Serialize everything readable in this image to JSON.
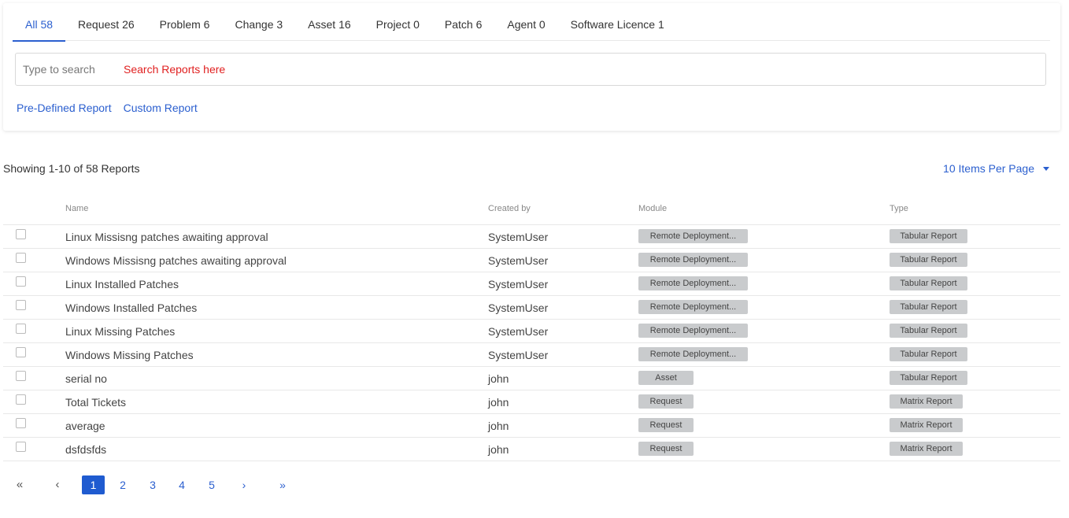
{
  "tabs": [
    {
      "label": "All 58"
    },
    {
      "label": "Request 26"
    },
    {
      "label": "Problem 6"
    },
    {
      "label": "Change 3"
    },
    {
      "label": "Asset 16"
    },
    {
      "label": "Project 0"
    },
    {
      "label": "Patch 6"
    },
    {
      "label": "Agent 0"
    },
    {
      "label": "Software Licence 1"
    }
  ],
  "search": {
    "placeholder": "Type to search",
    "hint": "Search Reports here"
  },
  "report_links": {
    "predefined": "Pre-Defined Report",
    "custom": "Custom Report"
  },
  "summary": {
    "showing": "Showing 1-10 of 58 Reports",
    "per_page": "10 Items Per Page"
  },
  "table": {
    "headers": {
      "name": "Name",
      "created_by": "Created by",
      "module": "Module",
      "type": "Type"
    },
    "rows": [
      {
        "name": "Linux Missisng patches awaiting approval",
        "created_by": "SystemUser",
        "module": "Remote Deployment...",
        "type": "Tabular Report"
      },
      {
        "name": "Windows Missisng patches awaiting approval",
        "created_by": "SystemUser",
        "module": "Remote Deployment...",
        "type": "Tabular Report"
      },
      {
        "name": "Linux Installed Patches",
        "created_by": "SystemUser",
        "module": "Remote Deployment...",
        "type": "Tabular Report"
      },
      {
        "name": "Windows Installed Patches",
        "created_by": "SystemUser",
        "module": "Remote Deployment...",
        "type": "Tabular Report"
      },
      {
        "name": "Linux Missing Patches",
        "created_by": "SystemUser",
        "module": "Remote Deployment...",
        "type": "Tabular Report"
      },
      {
        "name": "Windows Missing Patches",
        "created_by": "SystemUser",
        "module": "Remote Deployment...",
        "type": "Tabular Report"
      },
      {
        "name": "serial no",
        "created_by": "john",
        "module": "Asset",
        "type": "Tabular Report"
      },
      {
        "name": "Total Tickets",
        "created_by": "john",
        "module": "Request",
        "type": "Matrix Report"
      },
      {
        "name": "average",
        "created_by": "john",
        "module": "Request",
        "type": "Matrix Report"
      },
      {
        "name": "dsfdsfds",
        "created_by": "john",
        "module": "Request",
        "type": "Matrix Report"
      }
    ]
  },
  "pagination": {
    "first": "«",
    "prev": "‹",
    "pages": [
      "1",
      "2",
      "3",
      "4",
      "5"
    ],
    "current": "1",
    "next": "›",
    "last": "»"
  },
  "colors": {
    "accent": "#2b5fcf",
    "hint": "#e02020",
    "badge": "#c9cbcd"
  }
}
